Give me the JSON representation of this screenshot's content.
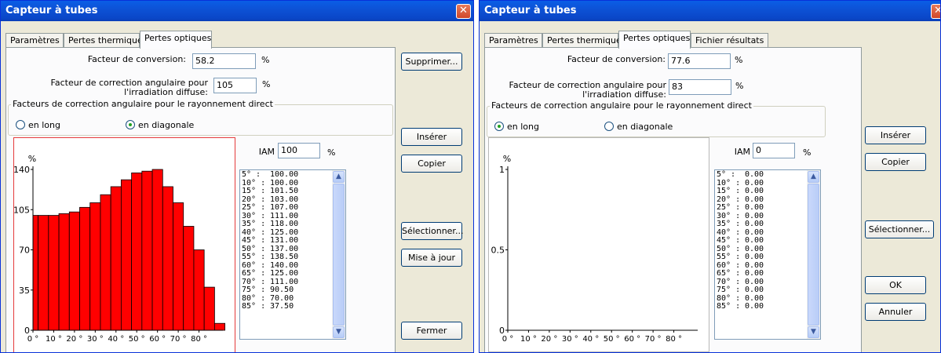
{
  "windows": [
    {
      "title": "Capteur à tubes",
      "close_glyph": "✕",
      "tabs": [
        "Paramètres",
        "Pertes thermiques",
        "Pertes optiques"
      ],
      "active_tab": 2,
      "conversion_label": "Facteur de conversion:",
      "conversion_value": "58.2",
      "conversion_unit": "%",
      "diffuse_label_1": "Facteur de correction angulaire pour",
      "diffuse_label_2": "l'irradiation diffuse:",
      "diffuse_value": "105",
      "diffuse_unit": "%",
      "group_title": "Facteurs de correction angulaire pour le rayonnement direct",
      "radio_long": "en long",
      "radio_diag": "en diagonale",
      "radio_selected": "diag",
      "iam_label": "IAM",
      "iam_value": "100",
      "iam_unit": "%",
      "list": [
        {
          "angle": "5° :",
          "value": "100.00"
        },
        {
          "angle": "10° :",
          "value": "100.00"
        },
        {
          "angle": "15° :",
          "value": "101.50"
        },
        {
          "angle": "20° :",
          "value": "103.00"
        },
        {
          "angle": "25° :",
          "value": "107.00"
        },
        {
          "angle": "30° :",
          "value": "111.00"
        },
        {
          "angle": "35° :",
          "value": "118.00"
        },
        {
          "angle": "40° :",
          "value": "125.00"
        },
        {
          "angle": "45° :",
          "value": "131.00"
        },
        {
          "angle": "50° :",
          "value": "137.00"
        },
        {
          "angle": "55° :",
          "value": "138.50"
        },
        {
          "angle": "60° :",
          "value": "140.00"
        },
        {
          "angle": "65° :",
          "value": "125.00"
        },
        {
          "angle": "70° :",
          "value": "111.00"
        },
        {
          "angle": "75° :",
          "value": "90.50"
        },
        {
          "angle": "80° :",
          "value": "70.00"
        },
        {
          "angle": "85° :",
          "value": "37.50"
        }
      ],
      "buttons": {
        "delete": "Supprimer...",
        "insert": "Insérer",
        "copy": "Copier",
        "select": "Sélectionner...",
        "update": "Mise à jour",
        "close": "Fermer"
      }
    },
    {
      "title": "Capteur à tubes",
      "tabs": [
        "Paramètres",
        "Pertes thermiques",
        "Pertes optiques",
        "Fichier résultats"
      ],
      "active_tab": 2,
      "conversion_label": "Facteur de conversion:",
      "conversion_value": "77.6",
      "conversion_unit": "%",
      "diffuse_label_1": "Facteur de correction angulaire pour",
      "diffuse_label_2": "l'irradiation diffuse:",
      "diffuse_value": "83",
      "diffuse_unit": "%",
      "group_title": "Facteurs de correction angulaire pour le rayonnement direct",
      "radio_long": "en long",
      "radio_diag": "en diagonale",
      "radio_selected": "long",
      "iam_label": "IAM",
      "iam_value": "0",
      "iam_unit": "%",
      "list": [
        {
          "angle": "5° :",
          "value": "0.00"
        },
        {
          "angle": "10° :",
          "value": "0.00"
        },
        {
          "angle": "15° :",
          "value": "0.00"
        },
        {
          "angle": "20° :",
          "value": "0.00"
        },
        {
          "angle": "25° :",
          "value": "0.00"
        },
        {
          "angle": "30° :",
          "value": "0.00"
        },
        {
          "angle": "35° :",
          "value": "0.00"
        },
        {
          "angle": "40° :",
          "value": "0.00"
        },
        {
          "angle": "45° :",
          "value": "0.00"
        },
        {
          "angle": "50° :",
          "value": "0.00"
        },
        {
          "angle": "55° :",
          "value": "0.00"
        },
        {
          "angle": "60° :",
          "value": "0.00"
        },
        {
          "angle": "65° :",
          "value": "0.00"
        },
        {
          "angle": "70° :",
          "value": "0.00"
        },
        {
          "angle": "75° :",
          "value": "0.00"
        },
        {
          "angle": "80° :",
          "value": "0.00"
        },
        {
          "angle": "85° :",
          "value": "0.00"
        }
      ],
      "buttons": {
        "insert": "Insérer",
        "copy": "Copier",
        "select": "Sélectionner...",
        "ok": "OK",
        "cancel": "Annuler"
      }
    }
  ],
  "chart_data": [
    {
      "type": "bar",
      "ylabel": "%",
      "x_ticks": [
        "0 °",
        "10 °",
        "20 °",
        "30 °",
        "40 °",
        "50 °",
        "60 °",
        "70 °",
        "80 °"
      ],
      "y_ticks": [
        "0",
        "35",
        "70",
        "105",
        "140"
      ],
      "ylim": [
        0,
        140
      ],
      "xlim": [
        0,
        90
      ],
      "x": [
        0,
        5,
        10,
        15,
        20,
        25,
        30,
        35,
        40,
        45,
        50,
        55,
        60,
        65,
        70,
        75,
        80,
        85
      ],
      "values": [
        100,
        100,
        100,
        101.5,
        103,
        107,
        111,
        118,
        125,
        131,
        137,
        138.5,
        140,
        125,
        111,
        90.5,
        70,
        37.5
      ],
      "extra_bar": {
        "x": 90,
        "value": 6
      },
      "bar_color": "#ff0000"
    },
    {
      "type": "bar",
      "ylabel": "%",
      "x_ticks": [
        "0 °",
        "10 °",
        "20 °",
        "30 °",
        "40 °",
        "50 °",
        "60 °",
        "70 °",
        "80 °"
      ],
      "y_ticks": [
        "0",
        "0.5",
        "1"
      ],
      "ylim": [
        0,
        1
      ],
      "xlim": [
        0,
        90
      ],
      "x": [
        5,
        10,
        15,
        20,
        25,
        30,
        35,
        40,
        45,
        50,
        55,
        60,
        65,
        70,
        75,
        80,
        85
      ],
      "values": [
        0,
        0,
        0,
        0,
        0,
        0,
        0,
        0,
        0,
        0,
        0,
        0,
        0,
        0,
        0,
        0,
        0
      ],
      "bar_color": "#ff0000"
    }
  ]
}
